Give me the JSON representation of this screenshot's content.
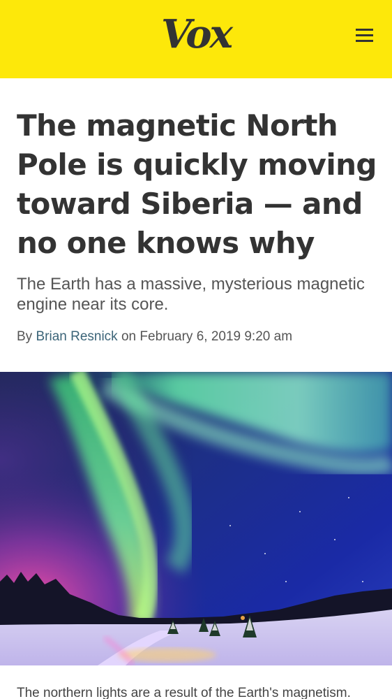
{
  "header": {
    "logo_text": "Vox",
    "menu_icon": "hamburger-menu-icon",
    "background_color": "#fde80a"
  },
  "article": {
    "headline": "The magnetic North Pole is quickly moving toward Siberia — and no one knows why",
    "dek": "The Earth has a massive, mysterious magnetic engine near its core.",
    "byline": {
      "prefix": "By",
      "author": "Brian Resnick",
      "on": "on",
      "date": "February 6, 2019 9:20 am"
    },
    "hero_image": {
      "subject": "aurora-borealis-over-snowy-landscape"
    },
    "caption": "The northern lights are a result of the Earth's magnetism."
  },
  "colors": {
    "text": "#333333",
    "link": "#3b6478"
  }
}
